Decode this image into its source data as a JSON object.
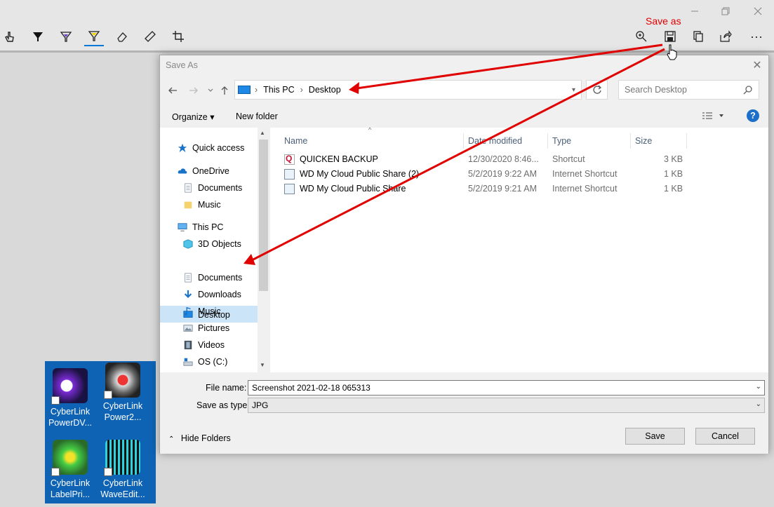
{
  "annotation": {
    "save_as_label": "Save as"
  },
  "app": {
    "tools": [
      "touch-writing-icon",
      "ballpoint-pen-icon",
      "pencil-icon",
      "highlighter-icon",
      "eraser-icon",
      "ruler-icon",
      "crop-icon"
    ],
    "right_tools": [
      "zoom-icon",
      "save-icon",
      "copy-icon",
      "share-icon",
      "more-icon"
    ],
    "more_label": "···"
  },
  "dialog": {
    "title": "Save As",
    "breadcrumb": [
      "This PC",
      "Desktop"
    ],
    "search_placeholder": "Search Desktop",
    "organize_label": "Organize ▾",
    "new_folder_label": "New folder",
    "nav": [
      {
        "label": "Quick access",
        "icon": "star-icon"
      },
      {
        "label": "OneDrive",
        "icon": "cloud-icon"
      },
      {
        "label": "Documents",
        "icon": "document-icon"
      },
      {
        "label": "Music",
        "icon": "folder-icon"
      },
      {
        "label": "This PC",
        "icon": "computer-icon"
      },
      {
        "label": "3D Objects",
        "icon": "cube-icon"
      },
      {
        "label": "Desktop",
        "icon": "desktop-icon",
        "selected": true
      },
      {
        "label": "Documents",
        "icon": "document-icon"
      },
      {
        "label": "Downloads",
        "icon": "download-icon"
      },
      {
        "label": "Music",
        "icon": "music-icon"
      },
      {
        "label": "Pictures",
        "icon": "pictures-icon"
      },
      {
        "label": "Videos",
        "icon": "video-icon"
      },
      {
        "label": "OS (C:)",
        "icon": "drive-icon"
      }
    ],
    "columns": [
      "Name",
      "Date modified",
      "Type",
      "Size"
    ],
    "files": [
      {
        "name": "QUICKEN BACKUP",
        "date": "12/30/2020 8:46...",
        "type": "Shortcut",
        "size": "3 KB"
      },
      {
        "name": "WD My Cloud Public Share (2)",
        "date": "5/2/2019 9:22 AM",
        "type": "Internet Shortcut",
        "size": "1 KB"
      },
      {
        "name": "WD My Cloud Public Share",
        "date": "5/2/2019 9:21 AM",
        "type": "Internet Shortcut",
        "size": "1 KB"
      }
    ],
    "file_name_label": "File name:",
    "file_name_value": "Screenshot 2021-02-18 065313",
    "save_type_label": "Save as type:",
    "save_type_value": "JPG",
    "save_label": "Save",
    "cancel_label": "Cancel",
    "hide_folders_label": "Hide Folders"
  },
  "desktop_icons": [
    {
      "line1": "CyberLink",
      "line2": "PowerDV..."
    },
    {
      "line1": "CyberLink",
      "line2": "Power2..."
    },
    {
      "line1": "CyberLink",
      "line2": "LabelPri..."
    },
    {
      "line1": "CyberLink",
      "line2": "WaveEdit..."
    }
  ]
}
